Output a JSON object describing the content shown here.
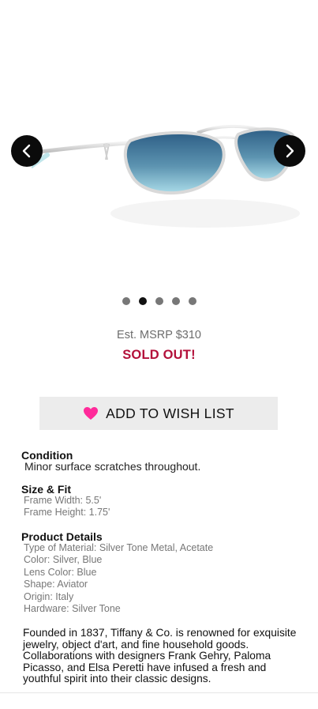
{
  "gallery": {
    "prev_icon": "chevron-left-icon",
    "next_icon": "chevron-right-icon",
    "image_alt": "sunglasses-image",
    "dots": [
      false,
      true,
      false,
      false,
      false
    ]
  },
  "pricing": {
    "msrp": "Est. MSRP $310",
    "status": "SOLD OUT!",
    "status_color": "#b3103a"
  },
  "wishlist": {
    "label": "ADD TO WISH LIST",
    "icon": "heart-icon",
    "icon_color": "#ff2a9a"
  },
  "condition": {
    "title": "Condition",
    "text": "Minor surface scratches throughout."
  },
  "size_fit": {
    "title": "Size & Fit",
    "lines": [
      "Frame Width: 5.5'",
      "Frame Height: 1.75'"
    ]
  },
  "product_details": {
    "title": "Product Details",
    "lines": [
      "Type of Material: Silver Tone Metal, Acetate",
      "Color: Silver, Blue",
      "Lens Color: Blue",
      "Shape: Aviator",
      "Origin: Italy",
      "Hardware: Silver Tone"
    ]
  },
  "description": "Founded in 1837, Tiffany & Co. is renowned for exquisite jewelry, object d'art, and fine household goods. Collaborations with designers Frank Gehry, Paloma Picasso, and Elsa Peretti have infused a fresh and youthful spirit into their classic designs."
}
